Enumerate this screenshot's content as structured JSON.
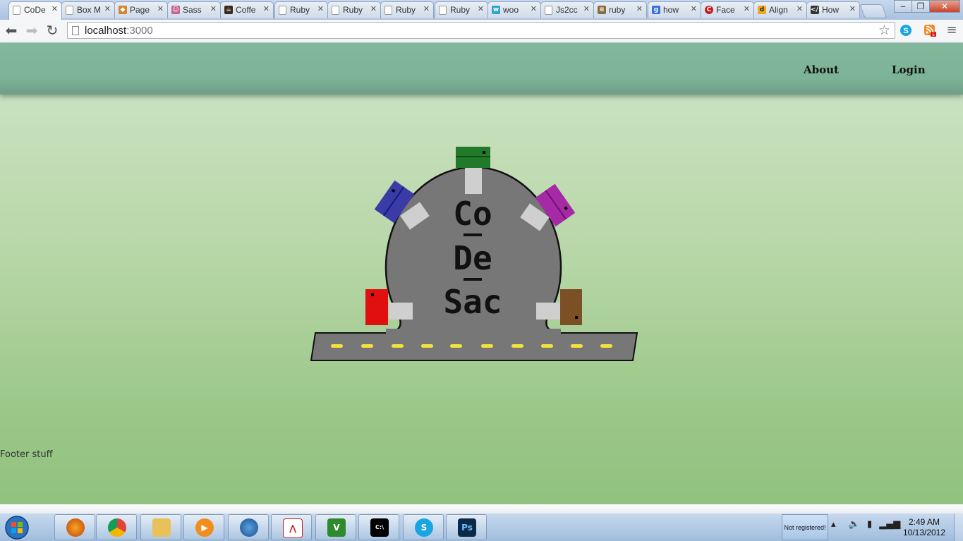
{
  "browser": {
    "tabs": [
      {
        "label": "CoDe",
        "icon": "page-icon",
        "active": true
      },
      {
        "label": "Box M",
        "icon": "page-icon"
      },
      {
        "label": "Page",
        "icon": "fox-icon"
      },
      {
        "label": "Sass",
        "icon": "sass-icon"
      },
      {
        "label": "Coffe",
        "icon": "coffee-icon"
      },
      {
        "label": "Ruby",
        "icon": "page-icon"
      },
      {
        "label": "Ruby",
        "icon": "page-icon"
      },
      {
        "label": "Ruby",
        "icon": "page-icon"
      },
      {
        "label": "Ruby",
        "icon": "page-icon"
      },
      {
        "label": "woo",
        "icon": "woo-icon"
      },
      {
        "label": "Js2cc",
        "icon": "page-icon"
      },
      {
        "label": "ruby",
        "icon": "stack-icon"
      },
      {
        "label": "how",
        "icon": "google-icon"
      },
      {
        "label": "Face",
        "icon": "red-c-icon"
      },
      {
        "label": "Align",
        "icon": "d-icon"
      },
      {
        "label": "How",
        "icon": "code-icon"
      }
    ],
    "url_host": "localhost",
    "url_port": ":3000"
  },
  "site": {
    "nav": {
      "about": "About",
      "login": "Login"
    },
    "logo": {
      "line1": "Co",
      "line2": "De",
      "line3": "Sac"
    },
    "footer": "Footer stuff"
  },
  "taskbar": {
    "apps": [
      "firefox",
      "chrome",
      "explorer",
      "media-player",
      "thunderbird",
      "acrobat",
      "vim",
      "cmd",
      "skype",
      "photoshop"
    ],
    "not_registered": "Not registered!",
    "time": "2:49 AM",
    "date": "10/13/2012"
  },
  "colors": {
    "header": "#7db397",
    "page_top": "#cfe4c8",
    "page_bottom": "#91c27f",
    "road": "#777777",
    "dash": "#f2e33a",
    "car_green": "#217a2a",
    "car_blue": "#3b3ba8",
    "car_magenta": "#a62aa6",
    "car_red": "#e01010",
    "car_brown": "#7a5024"
  }
}
